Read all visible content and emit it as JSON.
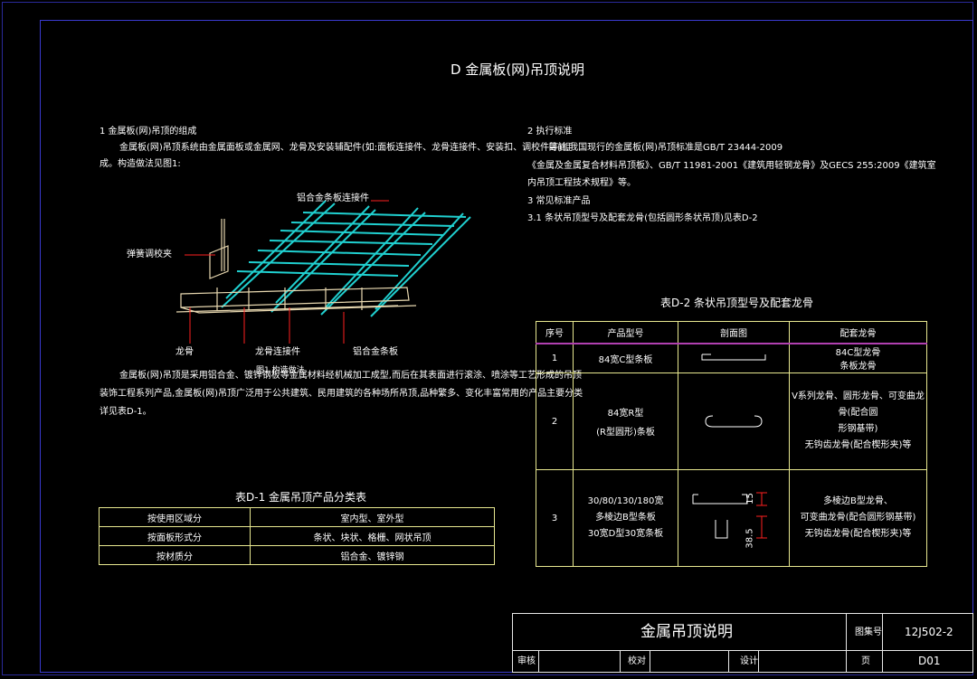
{
  "title": "D 金属板(网)吊顶说明",
  "section1": {
    "heading": "1    金属板(网)吊顶的组成",
    "line1": "金属板(网)吊顶系统由金属面板或金属网、龙骨及安装辅配件(如:面板连接件、龙骨连接件、安装扣、调校件等)组",
    "line2": "成。构造做法见图1:"
  },
  "section2": {
    "heading": "2    执行标准",
    "line1": "目前,我国现行的金属板(网)吊顶标准是GB/T 23444-2009",
    "line2": "《金属及金属复合材料吊顶板》、GB/T 11981-2001《建筑用轻钢龙骨》及GECS 255:2009《建筑室",
    "line3": "内吊顶工程技术规程》等。"
  },
  "section3": {
    "heading": "3    常见标准产品",
    "sub": "3.1  条状吊顶型号及配套龙骨(包括圆形条状吊顶)见表D-2"
  },
  "figure1": {
    "label_top": "铝合金条板连接件",
    "label_left": "弹簧调校夹",
    "label_bottom1": "龙骨",
    "label_bottom2": "龙骨连接件",
    "label_bottom3": "铝合金条板",
    "caption": "图1 构造做法"
  },
  "para": {
    "line1": "金属板(网)吊顶是采用铝合金、镀锌钢板等金属材料经机械加工成型,而后在其表面进行滚涂、喷涂等工艺形成的吊顶",
    "line2": "装饰工程系列产品,金属板(网)吊顶广泛用于公共建筑、民用建筑的各种场所吊顶,品种繁多、变化丰富常用的产品主要分类",
    "line3": "详见表D-1。"
  },
  "tableD1": {
    "caption": "表D-1  金属吊顶产品分类表",
    "rows": [
      {
        "k": "按使用区域分",
        "v": "室内型、室外型"
      },
      {
        "k": "按面板形式分",
        "v": "条状、块状、格栅、网状吊顶"
      },
      {
        "k": "按材质分",
        "v": "铝合金、镀锌钢"
      }
    ]
  },
  "tableD2": {
    "caption": "表D-2  条状吊顶型号及配套龙骨",
    "headers": [
      "序号",
      "产品型号",
      "剖面图",
      "配套龙骨"
    ],
    "rows": [
      {
        "no": "1",
        "model1": "84宽C型条板",
        "model2": "",
        "model3": "",
        "keel1": "84C型龙骨",
        "keel2": "条板龙骨",
        "keel3": ""
      },
      {
        "no": "2",
        "model1": "84宽R型",
        "model2": "(R型圆形)条板",
        "model3": "",
        "keel1": "V系列龙骨、圆形龙骨、可变曲龙骨(配合圆",
        "keel2": "形钢基带)",
        "keel3": "无钩齿龙骨(配合楔形夹)等"
      },
      {
        "no": "3",
        "model1": "30/80/130/180宽",
        "model2": "多棱边B型条板",
        "model3": "30宽D型30宽条板",
        "keel1": "多棱边B型龙骨、",
        "keel2": "可变曲龙骨(配合圆形钢基带)",
        "keel3": "无钩齿龙骨(配合楔形夹)等"
      }
    ],
    "dim1": "15",
    "dim2": "38.5"
  },
  "titleblock": {
    "name": "金属吊顶说明",
    "code_label": "图集号",
    "code": "12J502-2",
    "review": "审核",
    "check": "校对",
    "design": "设计",
    "page_label": "页",
    "page": "D01"
  },
  "colors": {
    "frame": "#3a3ad0",
    "table_line": "#e8e890",
    "header_divider": "#b040b0",
    "cyan": "#20d0d0",
    "red": "#ff2020",
    "beige": "#e8d8b0"
  }
}
